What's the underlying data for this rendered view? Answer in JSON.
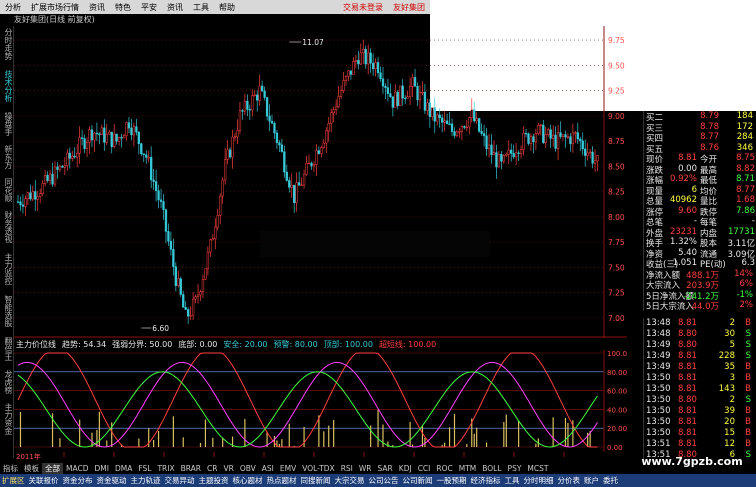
{
  "menu": {
    "items": [
      "分析",
      "扩展市场行情",
      "资讯",
      "特色",
      "平安",
      "资讯",
      "工具",
      "帮助"
    ],
    "right_items": [
      "交易未登录",
      "友好集团"
    ]
  },
  "chart_title": "友好集团(日线 前复权)",
  "left_nav": [
    "分时走势",
    "技术分析",
    "操盘手",
    "新东方",
    "同花顺",
    "财务透视",
    "主力监控",
    "智能选股",
    "翻倍王",
    "龙虎榜",
    "主力资金"
  ],
  "indicator_bar": {
    "name": "主力价位线",
    "items": [
      {
        "label": "趋势:",
        "value": "54.34",
        "color": "#e8e8e8"
      },
      {
        "label": "强弱分界:",
        "value": "50.00",
        "color": "#e8e8e8"
      },
      {
        "label": "底部:",
        "value": "0.00",
        "color": "#e8e8e8"
      },
      {
        "label": "安全:",
        "value": "20.00",
        "color": "#36c9d8"
      },
      {
        "label": "预警:",
        "value": "80.00",
        "color": "#36c9d8"
      },
      {
        "label": "顶部:",
        "value": "100.00",
        "color": "#36c9d8"
      },
      {
        "label": "超短线:",
        "value": "100.00",
        "color": "#ff4040"
      }
    ]
  },
  "chart_data": {
    "type": "candlestick",
    "price_axis": [
      "9.75",
      "9.50",
      "9.25",
      "9.00",
      "8.75",
      "8.50",
      "8.25",
      "8.00",
      "7.75",
      "7.50",
      "7.25",
      "7.00"
    ],
    "ylim": [
      6.9,
      9.85
    ],
    "high_label": "11.07",
    "low_label": "6.60",
    "sub_axis": [
      "100.00",
      "80.00",
      "60.00",
      "40.00",
      "20.00",
      "0.00"
    ],
    "year_label": "2011年",
    "candles_count": 160
  },
  "indicator_tabs": [
    "指标",
    "模板",
    "全部",
    "MACD",
    "DMI",
    "DMA",
    "FSL",
    "TRIX",
    "BRAR",
    "CR",
    "VR",
    "OBV",
    "ASI",
    "EMV",
    "VOL-TDX",
    "RSI",
    "WR",
    "SAR",
    "KDJ",
    "CCI",
    "ROC",
    "MTM",
    "BOLL",
    "PSY",
    "MCST"
  ],
  "indicator_tab_selected": "全部",
  "bottom_tabs": [
    "扩展区",
    "关联报价",
    "资金分布",
    "资金驱动",
    "主力轨迹",
    "交易异动",
    "主题投资",
    "核心题材",
    "热点题材",
    "同搜新闻",
    "大宗交易",
    "公司公告",
    "公司新闻",
    "一股预期",
    "经济指标",
    "工具",
    "分时明细",
    "分价表",
    "账户",
    "委托"
  ],
  "quote": {
    "rows": [
      {
        "l1": "买二",
        "v1": "8.79",
        "v2": "184",
        "c1": "#ff4040",
        "c2": "#ffff40"
      },
      {
        "l1": "买三",
        "v1": "8.78",
        "v2": "172",
        "c1": "#ff4040",
        "c2": "#ffff40"
      },
      {
        "l1": "买四",
        "v1": "8.77",
        "v2": "284",
        "c1": "#ff4040",
        "c2": "#ffff40"
      },
      {
        "l1": "买五",
        "v1": "8.76",
        "v2": "346",
        "c1": "#ff4040",
        "c2": "#ffff40"
      },
      {
        "l1": "现价",
        "v1": "8.81",
        "l2": "今开",
        "v2": "8.75",
        "c1": "#ff4040",
        "c2": "#ff4040"
      },
      {
        "l1": "涨跌",
        "v1": "0.00",
        "l2": "最高",
        "v2": "8.82",
        "c1": "#e8e8e8",
        "c2": "#ff4040"
      },
      {
        "l1": "涨幅",
        "v1": "0.92%",
        "l2": "最低",
        "v2": "8.71",
        "c1": "#ff4040",
        "c2": "#40ff40"
      },
      {
        "l1": "现量",
        "v1": "6",
        "l2": "均价",
        "v2": "8.77",
        "c1": "#ffff40",
        "c2": "#ff4040"
      },
      {
        "l1": "总量",
        "v1": "40962",
        "l2": "量比",
        "v2": "1.68",
        "c1": "#ffff40",
        "c2": "#ff4040"
      },
      {
        "l1": "涨停",
        "v1": "9.60",
        "l2": "跌停",
        "v2": "7.86",
        "c1": "#ff4040",
        "c2": "#40ff40"
      },
      {
        "l1": "总笔",
        "v1": "-",
        "l2": "每笔",
        "v2": "-",
        "c1": "#e8e8e8",
        "c2": "#e8e8e8"
      },
      {
        "l1": "外盘",
        "v1": "23231",
        "l2": "内盘",
        "v2": "17731",
        "c1": "#ff4040",
        "c2": "#40ff40"
      },
      {
        "l1": "换手",
        "v1": "1.32%",
        "l2": "股本",
        "v2": "3.11亿",
        "c1": "#e8e8e8",
        "c2": "#e8e8e8"
      },
      {
        "l1": "净资",
        "v1": "5.40",
        "l2": "流通",
        "v2": "3.09亿",
        "c1": "#e8e8e8",
        "c2": "#e8e8e8"
      },
      {
        "l1": "收益(三)",
        "v1": "1.051",
        "l2": "PE(动)",
        "v2": "6.3",
        "c1": "#e8e8e8",
        "c2": "#e8e8e8"
      },
      {
        "l1": "净流入额",
        "v1": "488.1万",
        "v2": "14%",
        "c1": "#ff4040",
        "c2": "#ff4040"
      },
      {
        "l1": "大宗流入",
        "v1": "203.9万",
        "v2": "6%",
        "c1": "#ff4040",
        "c2": "#ff4040"
      },
      {
        "l1": "5日净流入额",
        "v1": "-241.2万",
        "v2": "-1%",
        "c1": "#40ff40",
        "c2": "#40ff40"
      },
      {
        "l1": "5日大宗流入",
        "v1": "44.0万",
        "v2": "2%",
        "c1": "#ff4040",
        "c2": "#ff4040"
      }
    ]
  },
  "ticks": [
    {
      "t": "13:48",
      "p": "8.81",
      "v": "2",
      "d": "B"
    },
    {
      "t": "13:48",
      "p": "8.80",
      "v": "30",
      "d": "S"
    },
    {
      "t": "13:49",
      "p": "8.80",
      "v": "5",
      "d": "S"
    },
    {
      "t": "13:49",
      "p": "8.81",
      "v": "228",
      "d": "S"
    },
    {
      "t": "13:49",
      "p": "8.81",
      "v": "35",
      "d": "B"
    },
    {
      "t": "13:50",
      "p": "8.81",
      "v": "3",
      "d": "B"
    },
    {
      "t": "13:50",
      "p": "8.81",
      "v": "143",
      "d": "B"
    },
    {
      "t": "13:50",
      "p": "8.80",
      "v": "2",
      "d": "S"
    },
    {
      "t": "13:50",
      "p": "8.81",
      "v": "39",
      "d": "B"
    },
    {
      "t": "13:50",
      "p": "8.81",
      "v": "20",
      "d": "B"
    },
    {
      "t": "13:50",
      "p": "8.81",
      "v": "15",
      "d": "B"
    },
    {
      "t": "13:51",
      "p": "8.81",
      "v": "12",
      "d": "B"
    },
    {
      "t": "13:51",
      "p": "8.80",
      "v": "6",
      "d": "S"
    }
  ],
  "watermark": "www.7gpzb.com",
  "colors": {
    "up": "#ff4040",
    "down": "#36c9d8",
    "grid": "#8a1010",
    "green": "#40ff40",
    "yellow": "#ffff40",
    "magenta": "#ff40ff"
  }
}
